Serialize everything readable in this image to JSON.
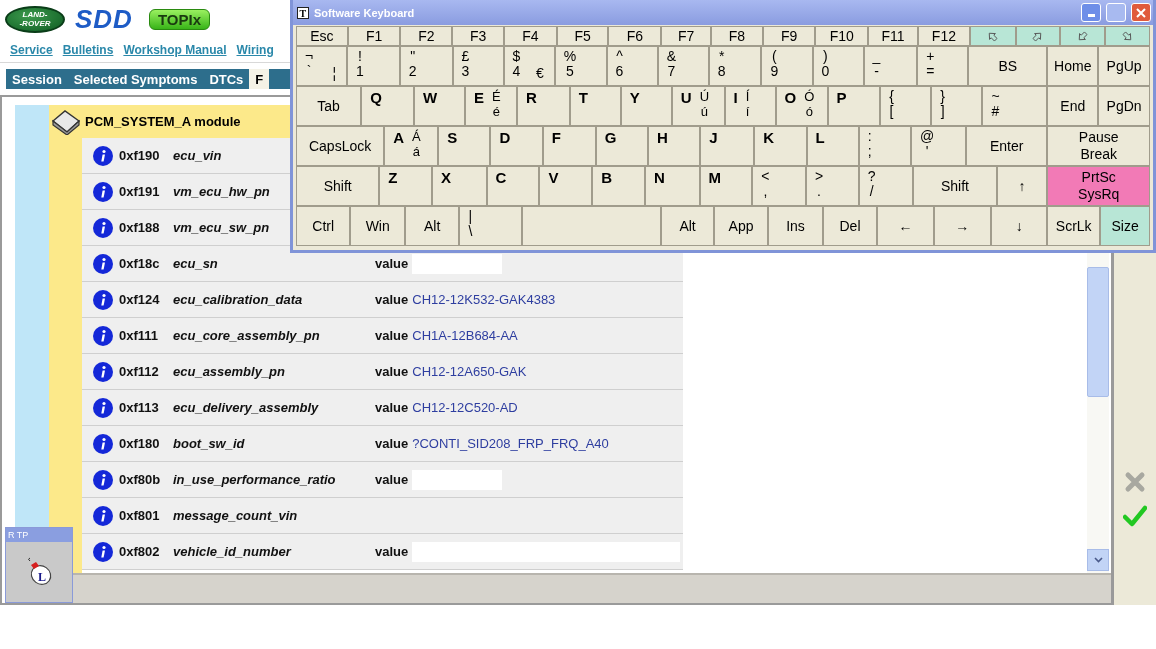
{
  "header": {
    "logo": {
      "line1": "LAND-",
      "line2": "-ROVER"
    },
    "product": "SDD",
    "badge": "TOPIx"
  },
  "links": [
    "Service",
    "Bulletins",
    "Workshop Manual",
    "Wiring"
  ],
  "tabs": [
    {
      "label": "Session",
      "selected": false
    },
    {
      "label": "Selected Symptoms",
      "selected": false
    },
    {
      "label": "DTCs",
      "selected": false
    },
    {
      "label": "F",
      "selected": true
    }
  ],
  "module": {
    "title": "PCM_SYSTEM_A module",
    "rows": [
      {
        "id": "0xf190",
        "name": "ecu_vin",
        "kind": "none"
      },
      {
        "id": "0xf191",
        "name": "vm_ecu_hw_pn",
        "kind": "none"
      },
      {
        "id": "0xf188",
        "name": "vm_ecu_sw_pn",
        "kind": "none"
      },
      {
        "id": "0xf18c",
        "name": "ecu_sn",
        "kind": "blank",
        "value_label": "value",
        "wide": false
      },
      {
        "id": "0xf124",
        "name": "ecu_calibration_data",
        "kind": "text",
        "value_label": "value",
        "value": "CH12-12K532-GAK4383"
      },
      {
        "id": "0xf111",
        "name": "ecu_core_assembly_pn",
        "kind": "text",
        "value_label": "value",
        "value": "CH1A-12B684-AA"
      },
      {
        "id": "0xf112",
        "name": "ecu_assembly_pn",
        "kind": "text",
        "value_label": "value",
        "value": "CH12-12A650-GAK"
      },
      {
        "id": "0xf113",
        "name": "ecu_delivery_assembly",
        "kind": "text",
        "value_label": "value",
        "value": "CH12-12C520-AD"
      },
      {
        "id": "0xf180",
        "name": "boot_sw_id",
        "kind": "text",
        "value_label": "value",
        "value": "?CONTI_SID208_FRP_FRQ_A40"
      },
      {
        "id": "0xf80b",
        "name": "in_use_performance_ratio",
        "kind": "blank",
        "value_label": "value",
        "wide": false
      },
      {
        "id": "0xf801",
        "name": "message_count_vin",
        "kind": "none"
      },
      {
        "id": "0xf802",
        "name": "vehicle_id_number",
        "kind": "blank",
        "value_label": "value",
        "wide": true
      }
    ]
  },
  "rtp": {
    "title": "R TP",
    "icon_letter": "L"
  },
  "keyboard": {
    "title": "Software Keyboard",
    "icon_letter": "T",
    "function_row": [
      {
        "kind": "text",
        "label": "Esc"
      },
      {
        "kind": "text",
        "label": "F1"
      },
      {
        "kind": "text",
        "label": "F2"
      },
      {
        "kind": "text",
        "label": "F3"
      },
      {
        "kind": "text",
        "label": "F4"
      },
      {
        "kind": "text",
        "label": "F5"
      },
      {
        "kind": "text",
        "label": "F6"
      },
      {
        "kind": "text",
        "label": "F7"
      },
      {
        "kind": "text",
        "label": "F8"
      },
      {
        "kind": "text",
        "label": "F9"
      },
      {
        "kind": "text",
        "label": "F10"
      },
      {
        "kind": "text",
        "label": "F11"
      },
      {
        "kind": "text",
        "label": "F12"
      },
      {
        "kind": "icon",
        "color": "#b8e6d6"
      },
      {
        "kind": "icon",
        "color": "#b8e6d6"
      },
      {
        "kind": "icon",
        "color": "#b8e6d6"
      },
      {
        "kind": "icon",
        "color": "#b8e6d6"
      }
    ],
    "main_rows": [
      [
        {
          "kind": "sym",
          "upper": "¬",
          "lower": "`",
          "extra": "¦"
        },
        {
          "kind": "sym",
          "upper": "!",
          "lower": "1"
        },
        {
          "kind": "sym",
          "upper": "\"",
          "lower": "2"
        },
        {
          "kind": "sym",
          "upper": "£",
          "lower": "3"
        },
        {
          "kind": "sym",
          "upper": "$",
          "lower": "4",
          "extra": "€"
        },
        {
          "kind": "sym",
          "upper": "%",
          "lower": "5"
        },
        {
          "kind": "sym",
          "upper": "^",
          "lower": "6"
        },
        {
          "kind": "sym",
          "upper": "&",
          "lower": "7"
        },
        {
          "kind": "sym",
          "upper": "*",
          "lower": "8"
        },
        {
          "kind": "sym",
          "upper": "(",
          "lower": "9"
        },
        {
          "kind": "sym",
          "upper": ")",
          "lower": "0"
        },
        {
          "kind": "sym",
          "upper": "_",
          "lower": "-"
        },
        {
          "kind": "sym",
          "upper": "+",
          "lower": "="
        },
        {
          "kind": "text",
          "label": "BS"
        }
      ],
      [
        {
          "kind": "text",
          "label": "Tab"
        },
        {
          "kind": "letter",
          "label": "Q"
        },
        {
          "kind": "letter",
          "label": "W"
        },
        {
          "kind": "letter",
          "label": "E",
          "accent_upper": "É",
          "accent_lower": "é"
        },
        {
          "kind": "letter",
          "label": "R"
        },
        {
          "kind": "letter",
          "label": "T"
        },
        {
          "kind": "letter",
          "label": "Y"
        },
        {
          "kind": "letter",
          "label": "U",
          "accent_upper": "Ú",
          "accent_lower": "ú"
        },
        {
          "kind": "letter",
          "label": "I",
          "accent_upper": "Í",
          "accent_lower": "í"
        },
        {
          "kind": "letter",
          "label": "O",
          "accent_upper": "Ó",
          "accent_lower": "ó"
        },
        {
          "kind": "letter",
          "label": "P"
        },
        {
          "kind": "sym",
          "upper": "{",
          "lower": "["
        },
        {
          "kind": "sym",
          "upper": "}",
          "lower": "]"
        },
        {
          "kind": "sym",
          "upper": "~",
          "lower": "#"
        }
      ],
      [
        {
          "kind": "text",
          "label": "CapsLock"
        },
        {
          "kind": "letter",
          "label": "A",
          "accent_upper": "Á",
          "accent_lower": "á"
        },
        {
          "kind": "letter",
          "label": "S"
        },
        {
          "kind": "letter",
          "label": "D"
        },
        {
          "kind": "letter",
          "label": "F"
        },
        {
          "kind": "letter",
          "label": "G"
        },
        {
          "kind": "letter",
          "label": "H"
        },
        {
          "kind": "letter",
          "label": "J"
        },
        {
          "kind": "letter",
          "label": "K"
        },
        {
          "kind": "letter",
          "label": "L"
        },
        {
          "kind": "sym",
          "upper": ":",
          "lower": ";"
        },
        {
          "kind": "sym",
          "upper": "@",
          "lower": "'"
        },
        {
          "kind": "text",
          "label": "Enter"
        }
      ],
      [
        {
          "kind": "text",
          "label": "Shift"
        },
        {
          "kind": "letter",
          "label": "Z"
        },
        {
          "kind": "letter",
          "label": "X"
        },
        {
          "kind": "letter",
          "label": "C"
        },
        {
          "kind": "letter",
          "label": "V"
        },
        {
          "kind": "letter",
          "label": "B"
        },
        {
          "kind": "letter",
          "label": "N"
        },
        {
          "kind": "letter",
          "label": "M"
        },
        {
          "kind": "sym",
          "upper": "<",
          "lower": ","
        },
        {
          "kind": "sym",
          "upper": ">",
          "lower": "."
        },
        {
          "kind": "sym",
          "upper": "?",
          "lower": "/"
        },
        {
          "kind": "text",
          "label": "Shift"
        },
        {
          "kind": "text",
          "label": "↑"
        }
      ],
      [
        {
          "kind": "text",
          "label": "Ctrl"
        },
        {
          "kind": "text",
          "label": "Win"
        },
        {
          "kind": "text",
          "label": "Alt"
        },
        {
          "kind": "sym",
          "upper": "|",
          "lower": "\\"
        },
        {
          "kind": "space"
        },
        {
          "kind": "text",
          "label": "Alt"
        },
        {
          "kind": "text",
          "label": "App"
        },
        {
          "kind": "text",
          "label": "Ins"
        },
        {
          "kind": "text",
          "label": "Del"
        },
        {
          "kind": "text",
          "label": "←"
        },
        {
          "kind": "text",
          "label": "→"
        },
        {
          "kind": "text",
          "label": "↓"
        }
      ]
    ],
    "nav_rows": [
      [
        {
          "kind": "text",
          "label": "Home"
        },
        {
          "kind": "text",
          "label": "PgUp"
        }
      ],
      [
        {
          "kind": "text",
          "label": "End"
        },
        {
          "kind": "text",
          "label": "PgDn"
        }
      ],
      [
        {
          "kind": "stacked",
          "upper": "Pause",
          "lower": "Break"
        }
      ],
      [
        {
          "kind": "stacked",
          "upper": "PrtSc",
          "lower": "SysRq",
          "color": "#f27ab6"
        }
      ],
      [
        {
          "kind": "text",
          "label": "ScrLk"
        },
        {
          "kind": "text",
          "label": "Size",
          "color": "#b8e6d6"
        }
      ]
    ]
  }
}
